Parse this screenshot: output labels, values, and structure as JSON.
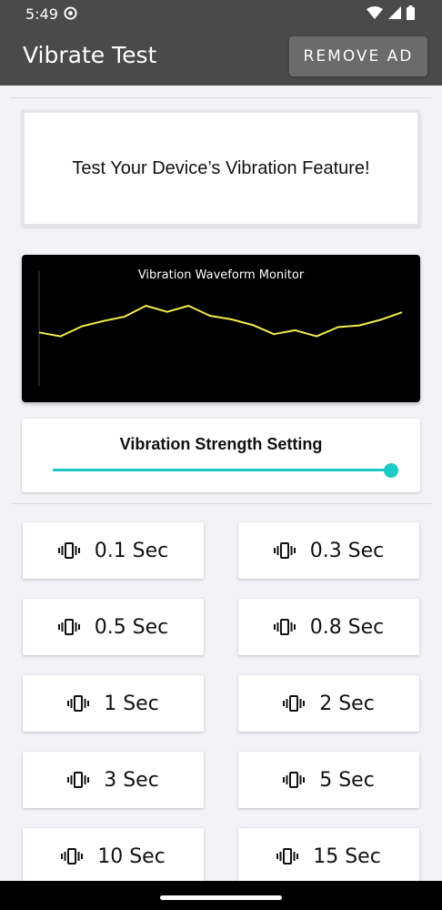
{
  "status": {
    "time": "5:49"
  },
  "app": {
    "title": "Vibrate Test",
    "remove_ad_label": "REMOVE AD"
  },
  "info": {
    "text": "Test Your Device’s Vibration Feature!"
  },
  "monitor": {
    "title": "Vibration Waveform Monitor",
    "line_color": "#f2ec4b",
    "waveform": [
      0.39,
      0.3,
      0.53,
      0.65,
      0.75,
      1.0,
      0.86,
      1.0,
      0.77,
      0.69,
      0.56,
      0.35,
      0.44,
      0.3,
      0.51,
      0.55,
      0.68,
      0.85
    ]
  },
  "strength": {
    "title": "Vibration Strength Setting",
    "value": 1.0,
    "accent": "#20c6c3"
  },
  "buttons": [
    {
      "label": "0.1 Sec",
      "icon": "vibrate-icon"
    },
    {
      "label": "0.3 Sec",
      "icon": "vibrate-icon"
    },
    {
      "label": "0.5 Sec",
      "icon": "vibrate-icon"
    },
    {
      "label": "0.8 Sec",
      "icon": "vibrate-icon"
    },
    {
      "label": "1 Sec",
      "icon": "vibrate-icon"
    },
    {
      "label": "2 Sec",
      "icon": "vibrate-icon"
    },
    {
      "label": "3 Sec",
      "icon": "vibrate-icon"
    },
    {
      "label": "5 Sec",
      "icon": "vibrate-icon"
    },
    {
      "label": "10 Sec",
      "icon": "vibrate-icon"
    },
    {
      "label": "15 Sec",
      "icon": "vibrate-icon"
    }
  ]
}
